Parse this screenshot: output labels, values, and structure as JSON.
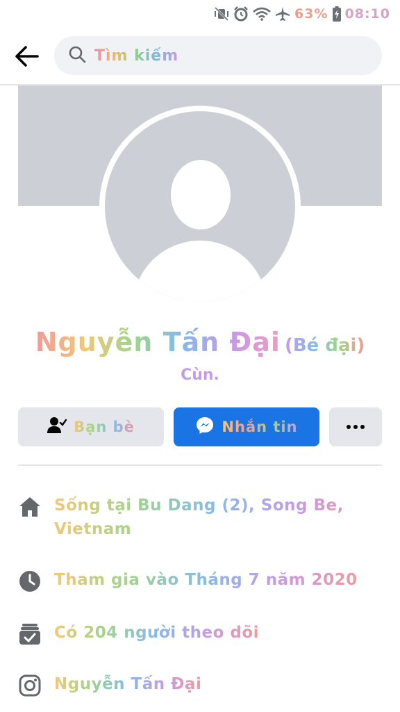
{
  "status_bar": {
    "icons": [
      "mute-vibrate-icon",
      "alarm-icon",
      "wifi-icon",
      "airplane-mode-icon",
      "battery-icon"
    ],
    "battery_percent": "63%",
    "time": "08:10"
  },
  "header": {
    "back_icon": "arrow-left-icon",
    "search_icon": "search-icon",
    "search_placeholder": "Tìm kiếm"
  },
  "profile": {
    "name": "Nguyễn Tấn Đại",
    "nickname": "(Bé đại)",
    "bio": "Cùn."
  },
  "actions": {
    "friends_label": "Bạn bè",
    "friends_icon": "friends-check-icon",
    "message_label": "Nhắn tin",
    "message_icon": "messenger-icon",
    "more_icon": "more-dots-icon",
    "message_color": "#1b74e4"
  },
  "details": [
    {
      "icon": "home-icon",
      "text": "Sống tại Bu Dang (2), Song Be, Vietnam"
    },
    {
      "icon": "clock-icon",
      "text": "Tham gia vào Tháng 7 năm 2020"
    },
    {
      "icon": "followers-icon",
      "text": "Có 204 người theo dõi"
    },
    {
      "icon": "instagram-icon",
      "text": "Nguyễn Tấn Đại"
    }
  ]
}
